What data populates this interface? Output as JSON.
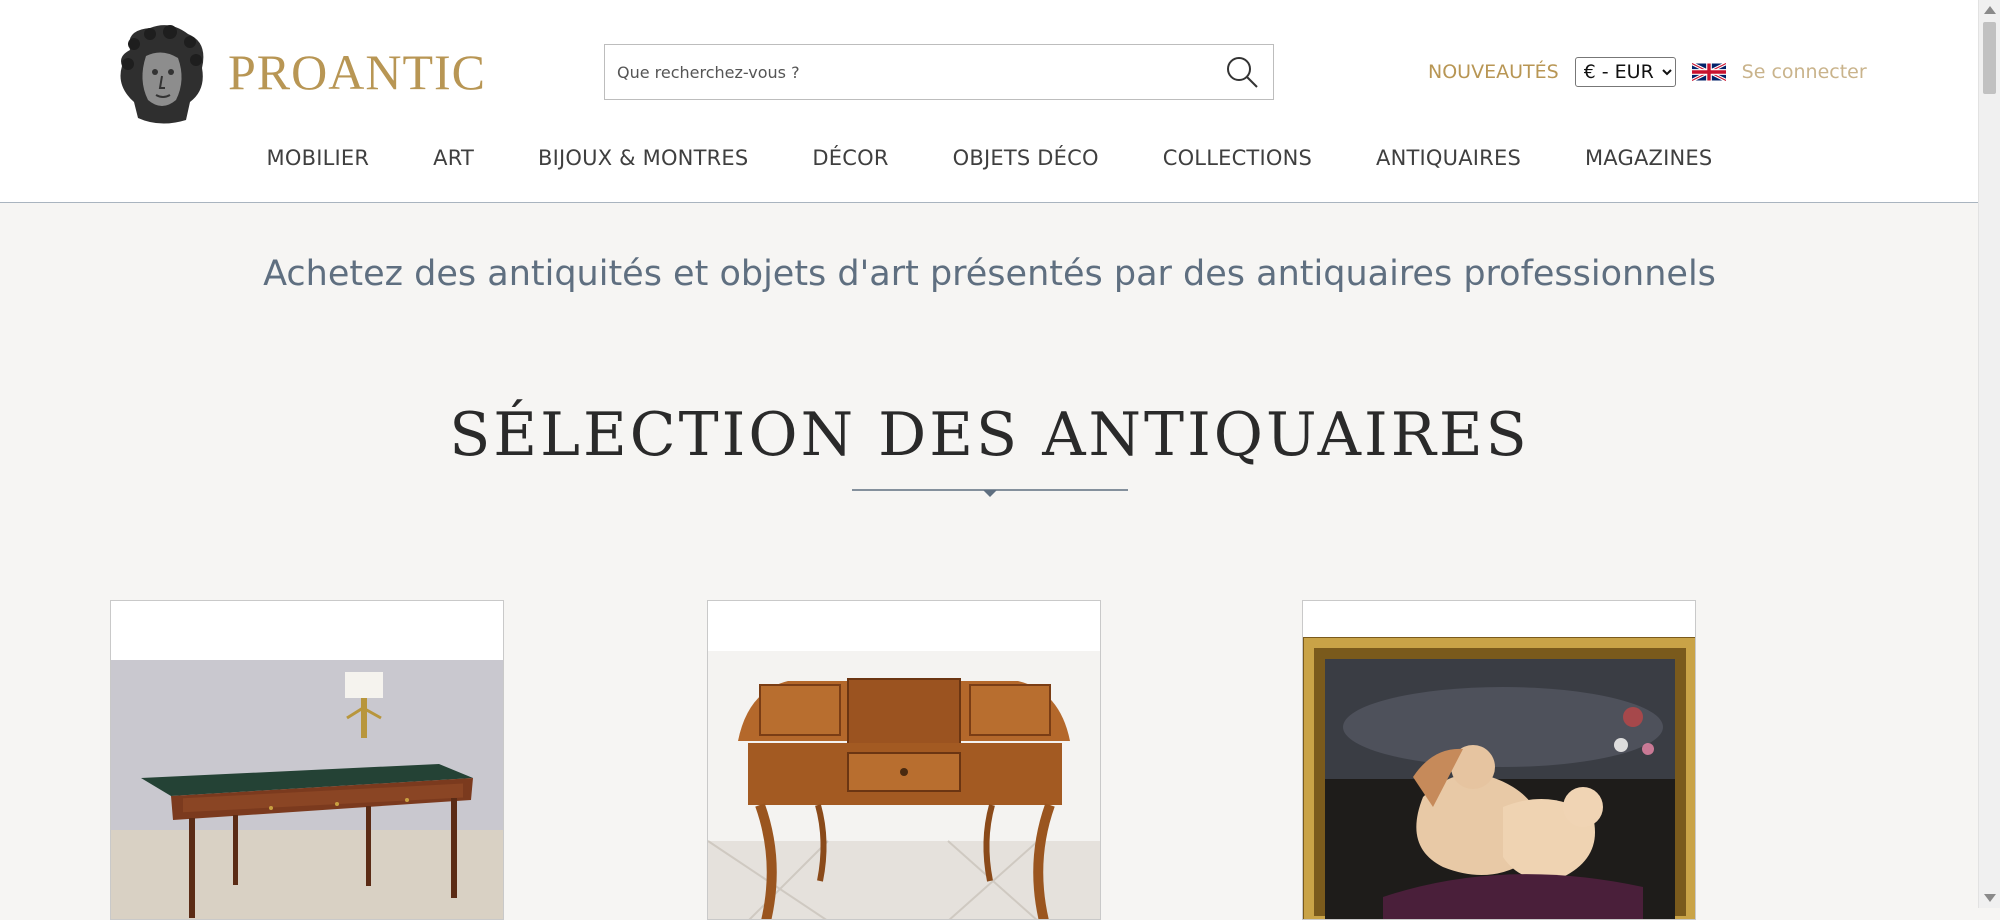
{
  "header": {
    "brand": "PROANTIC",
    "search_placeholder": "Que recherchez-vous ?",
    "new_label": "NOUVEAUTÉS",
    "currency_selected": "€ - EUR",
    "login_label": "Se connecter",
    "flag_icon": "uk-flag-icon"
  },
  "nav": {
    "items": [
      "MOBILIER",
      "ART",
      "BIJOUX & MONTRES",
      "DÉCOR",
      "OBJETS DÉCO",
      "COLLECTIONS",
      "ANTIQUAIRES",
      "MAGAZINES"
    ]
  },
  "main": {
    "tagline": "Achetez des antiquités et objets d'art présentés par des antiquaires professionnels",
    "section_title": "SÉLECTION DES ANTIQUAIRES"
  },
  "colors": {
    "brand_gold": "#b89654",
    "login_gold": "#c9b38b",
    "tagline_blue": "#5f6f80",
    "background": "#f6f5f3"
  }
}
